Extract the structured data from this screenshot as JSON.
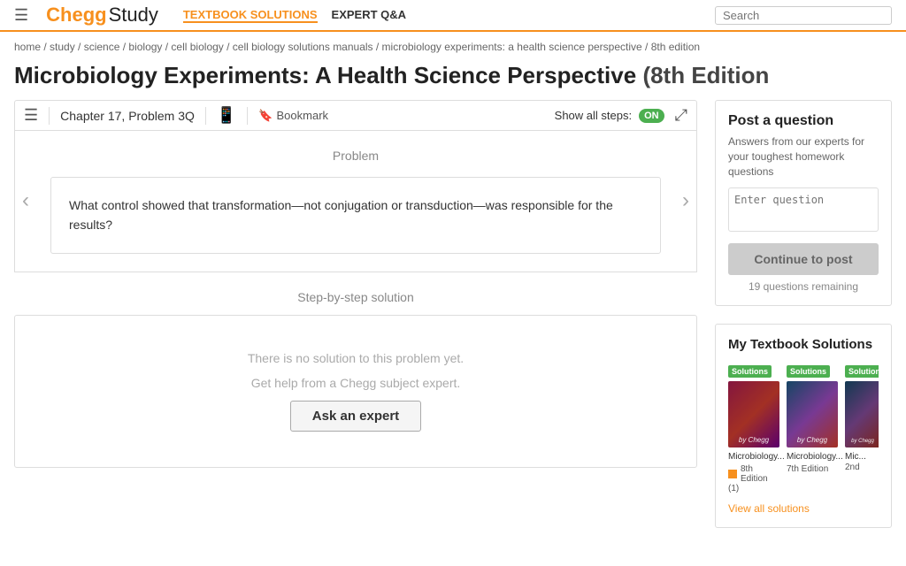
{
  "header": {
    "hamburger": "☰",
    "logo_chegg": "Chegg",
    "logo_study": "Study",
    "nav": [
      {
        "id": "textbook",
        "label": "TEXTBOOK SOLUTIONS",
        "active": true
      },
      {
        "id": "expert",
        "label": "EXPERT Q&A",
        "active": false
      }
    ],
    "search_placeholder": "Search"
  },
  "breadcrumb": {
    "items": [
      "home",
      "study",
      "science",
      "biology",
      "cell biology",
      "cell biology solutions manuals",
      "microbiology experiments: a health science perspective",
      "8th edition"
    ],
    "separator": " / "
  },
  "page": {
    "title": "Microbiology Experiments: A Health Science Perspective",
    "edition": "(8th Edition"
  },
  "toolbar": {
    "chapter_label": "Chapter 17, Problem 3Q",
    "bookmark_label": "Bookmark",
    "show_steps_label": "Show all steps:",
    "toggle_label": "ON",
    "list_icon": "≡",
    "mobile_icon": "□",
    "bookmark_icon": "🔖",
    "expand_icon": "⤢"
  },
  "problem": {
    "section_label": "Problem",
    "text": "What control showed that transformation—not conjugation or transduction—was responsible for the results?"
  },
  "solution": {
    "section_label": "Step-by-step solution",
    "no_solution_line1": "There is no solution to this problem yet.",
    "no_solution_line2": "Get help from a Chegg subject expert.",
    "ask_expert_label": "Ask an expert"
  },
  "post_question": {
    "title": "Post a question",
    "description": "Answers from our experts for your toughest homework questions",
    "textarea_placeholder": "Enter question",
    "button_label": "Continue to post",
    "remaining": "19 questions remaining"
  },
  "my_textbooks": {
    "title": "My Textbook Solutions",
    "books": [
      {
        "badge": "Solutions",
        "name": "Microbiology...",
        "edition": "8th Edition",
        "has_orange": true,
        "rating": "(1)"
      },
      {
        "badge": "Solutions",
        "name": "Microbiology...",
        "edition": "7th Edition",
        "has_orange": false
      },
      {
        "badge": "Solutions",
        "name": "Mic...",
        "edition": "2nd",
        "has_orange": false,
        "partial": true
      }
    ],
    "view_all_label": "View all solutions"
  }
}
